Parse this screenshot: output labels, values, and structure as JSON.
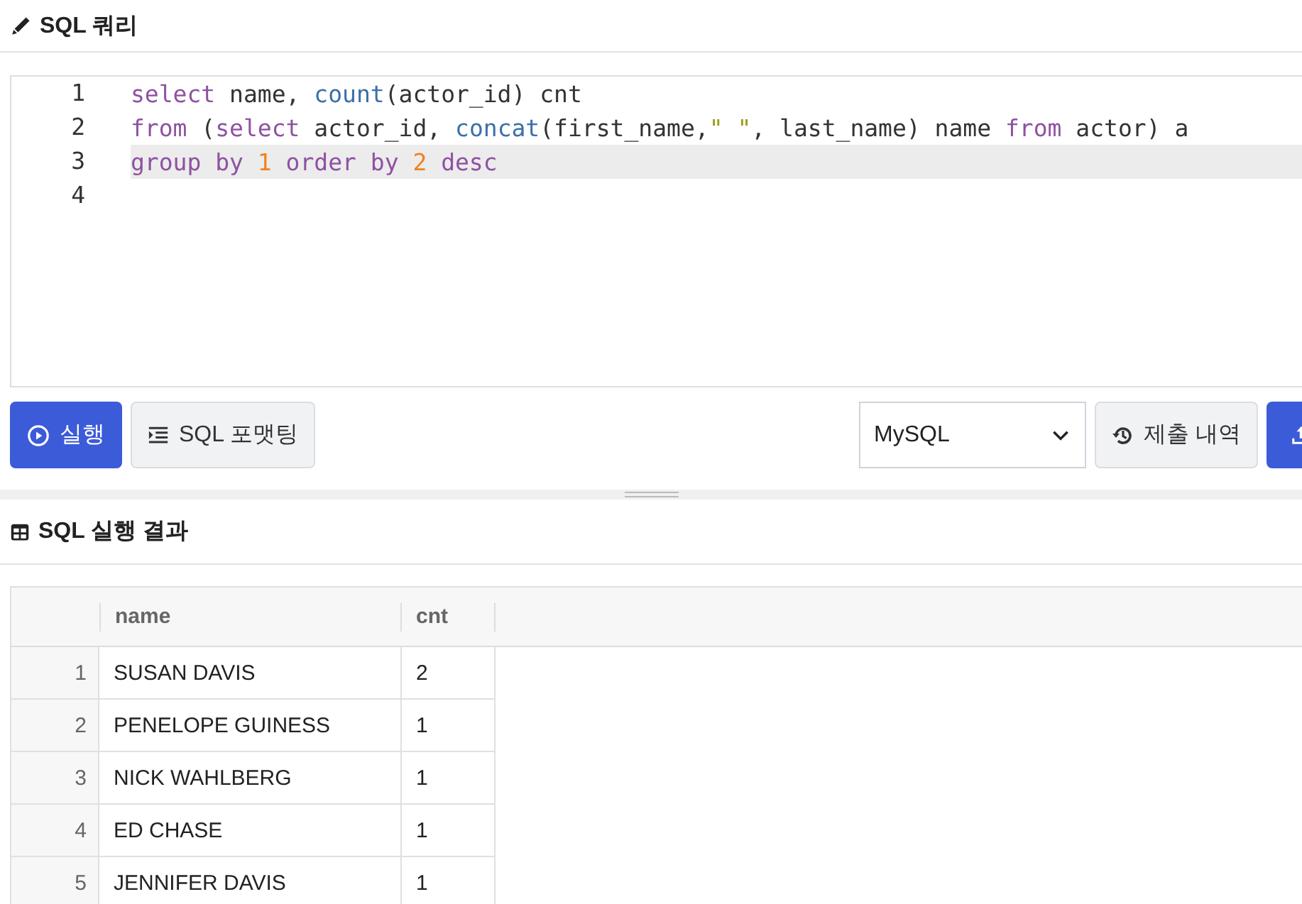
{
  "query_panel": {
    "title": "SQL 쿼리"
  },
  "editor": {
    "lines": [
      {
        "number": "1",
        "active": false,
        "tokens": [
          {
            "kind": "keyword",
            "text": "select"
          },
          {
            "kind": "plain",
            "text": " name, "
          },
          {
            "kind": "function",
            "text": "count"
          },
          {
            "kind": "plain",
            "text": "(actor_id) cnt"
          }
        ]
      },
      {
        "number": "2",
        "active": false,
        "tokens": [
          {
            "kind": "keyword",
            "text": "from"
          },
          {
            "kind": "plain",
            "text": " ("
          },
          {
            "kind": "keyword",
            "text": "select"
          },
          {
            "kind": "plain",
            "text": " actor_id, "
          },
          {
            "kind": "function",
            "text": "concat"
          },
          {
            "kind": "plain",
            "text": "(first_name,"
          },
          {
            "kind": "string",
            "text": "\" \""
          },
          {
            "kind": "plain",
            "text": ", last_name) name "
          },
          {
            "kind": "keyword",
            "text": "from"
          },
          {
            "kind": "plain",
            "text": " actor) a"
          }
        ]
      },
      {
        "number": "3",
        "active": true,
        "tokens": [
          {
            "kind": "keyword",
            "text": "group by "
          },
          {
            "kind": "number",
            "text": "1 "
          },
          {
            "kind": "keyword",
            "text": "order by "
          },
          {
            "kind": "number",
            "text": "2 "
          },
          {
            "kind": "keyword",
            "text": "desc"
          }
        ]
      },
      {
        "number": "4",
        "active": false
      }
    ]
  },
  "toolbar": {
    "run_button": "실행",
    "format_button": "SQL 포맷팅",
    "dialect": "MySQL",
    "history_button": "제출 내역"
  },
  "results_panel": {
    "title": "SQL 실행 결과"
  },
  "table": {
    "columns": [
      "name",
      "cnt"
    ],
    "rows": [
      {
        "index": "1",
        "cells": [
          "SUSAN DAVIS",
          "2"
        ]
      },
      {
        "index": "2",
        "cells": [
          "PENELOPE GUINESS",
          "1"
        ]
      },
      {
        "index": "3",
        "cells": [
          "NICK WAHLBERG",
          "1"
        ]
      },
      {
        "index": "4",
        "cells": [
          "ED CHASE",
          "1"
        ]
      },
      {
        "index": "5",
        "cells": [
          "JENNIFER DAVIS",
          "1"
        ]
      }
    ]
  }
}
